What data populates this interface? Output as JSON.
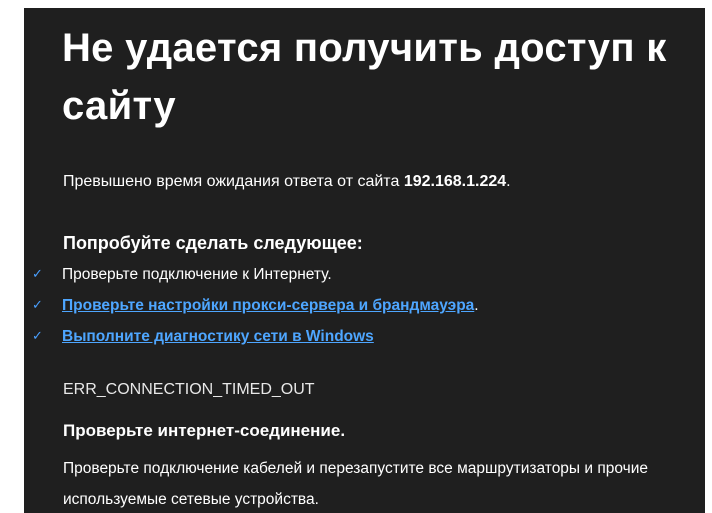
{
  "page": {
    "title": "Не удается получить доступ к сайту",
    "description_prefix": "Превышено время ожидания ответа от сайта",
    "host": "192.168.1.224",
    "description_suffix": ".",
    "try_heading": "Попробуйте сделать следующее:",
    "suggestions": [
      {
        "text": "Проверьте подключение к Интернету.",
        "link": "",
        "after": ""
      },
      {
        "text": "",
        "link": "Проверьте настройки прокси-сервера и брандмауэра",
        "after": "."
      },
      {
        "text": "",
        "link": "Выполните диагностику сети в Windows",
        "after": ""
      }
    ],
    "check_icon": "✓",
    "error_code": "ERR_CONNECTION_TIMED_OUT",
    "internet_heading": "Проверьте интернет-соединение.",
    "internet_text": "Проверьте подключение кабелей и перезапустите все маршрутизаторы и прочие используемые сетевые устройства."
  },
  "colors": {
    "background": "#1f1f1f",
    "text": "#ffffff",
    "link": "#4ea6ff",
    "check": "#4aa0ff"
  }
}
